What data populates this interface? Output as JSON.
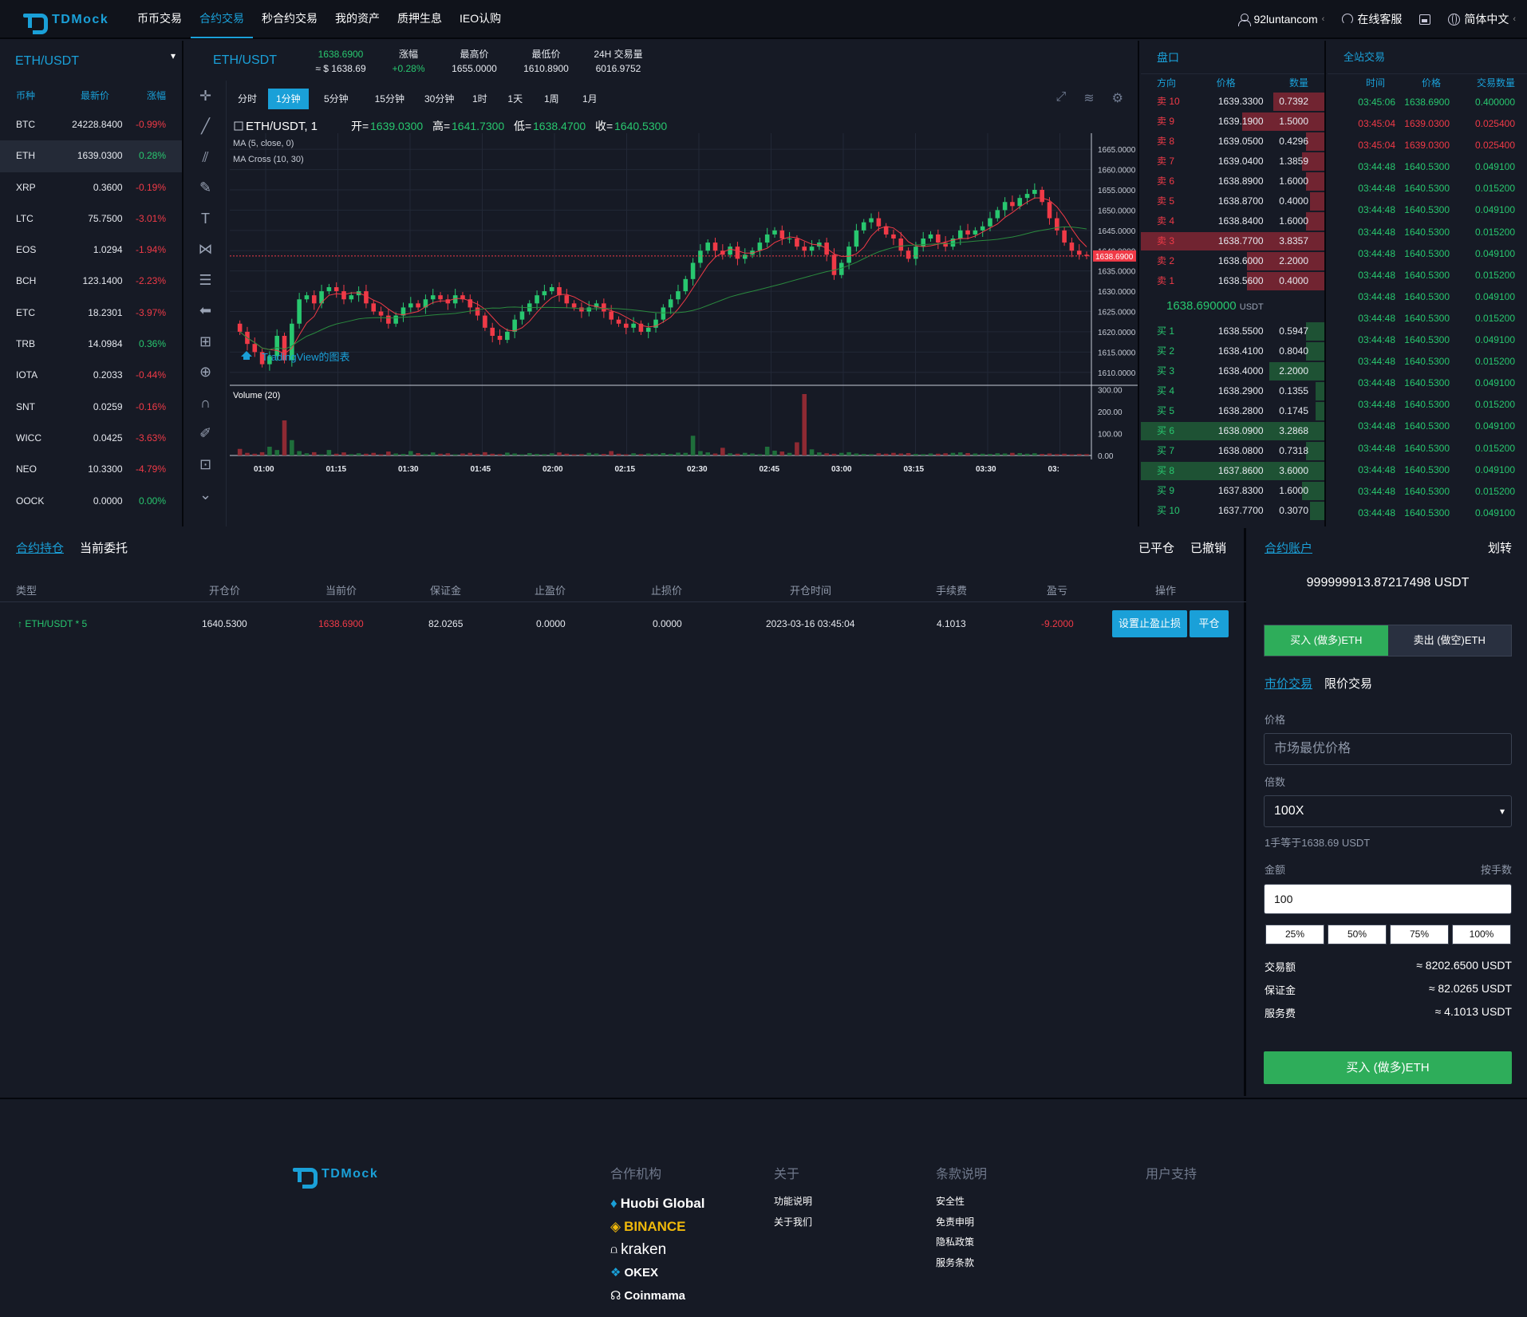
{
  "nav": {
    "brand": "TDMock",
    "items": [
      "币币交易",
      "合约交易",
      "秒合约交易",
      "我的资产",
      "质押生息",
      "IEO认购"
    ],
    "user": "92luntancom",
    "service": "在线客服",
    "lang": "简体中文"
  },
  "sidebar": {
    "title": "ETH/USDT",
    "headers": [
      "币种",
      "最新价",
      "涨幅"
    ],
    "rows": [
      [
        "BTC",
        "24228.8400",
        "-0.99%"
      ],
      [
        "ETH",
        "1639.0300",
        "0.28%"
      ],
      [
        "XRP",
        "0.3600",
        "-0.19%"
      ],
      [
        "LTC",
        "75.7500",
        "-3.01%"
      ],
      [
        "EOS",
        "1.0294",
        "-1.94%"
      ],
      [
        "BCH",
        "123.1400",
        "-2.23%"
      ],
      [
        "ETC",
        "18.2301",
        "-3.97%"
      ],
      [
        "TRB",
        "14.0984",
        "0.36%"
      ],
      [
        "IOTA",
        "0.2033",
        "-0.44%"
      ],
      [
        "SNT",
        "0.0259",
        "-0.16%"
      ],
      [
        "WICC",
        "0.0425",
        "-3.63%"
      ],
      [
        "NEO",
        "10.3300",
        "-4.79%"
      ],
      [
        "OOCK",
        "0.0000",
        "0.00%"
      ]
    ]
  },
  "ticker": {
    "symbol": "ETH/USDT",
    "price": "1638.6900",
    "approx": "≈ $ 1638.69",
    "change_label": "涨幅",
    "change": "+0.28%",
    "high_label": "最高价",
    "high": "1655.0000",
    "low_label": "最低价",
    "low": "1610.8900",
    "vol_label": "24H 交易量",
    "vol": "6016.9752"
  },
  "timeframes": [
    "分时",
    "1分钟",
    "5分钟",
    "15分钟",
    "30分钟",
    "1时",
    "1天",
    "1周",
    "1月"
  ],
  "legend": {
    "title": "ETH/USDT, 1",
    "o_label": "开=",
    "o": "1639.0300",
    "h_label": "高=",
    "h": "1641.7300",
    "l_label": "低=",
    "l": "1638.4700",
    "c_label": "收=",
    "c": "1640.5300",
    "ma": "MA (5, close, 0)",
    "macross": "MA Cross (10, 30)",
    "volume": "Volume (20)",
    "watermark": "TradingView的图表"
  },
  "chart_data": {
    "type": "candlestick",
    "x_ticks": [
      "01:00",
      "01:15",
      "01:30",
      "01:45",
      "02:00",
      "02:15",
      "02:30",
      "02:45",
      "03:00",
      "03:15",
      "03:30",
      "03:"
    ],
    "y_ticks": [
      "1665.0000",
      "1660.0000",
      "1655.0000",
      "1650.0000",
      "1645.0000",
      "1640.0000",
      "1635.0000",
      "1630.0000",
      "1625.0000",
      "1620.0000",
      "1615.0000",
      "1610.0000"
    ],
    "ylim": [
      1607,
      1667
    ],
    "last_price": "1638.6900",
    "vol_ticks": [
      "300.00",
      "200.00",
      "100.00",
      "0.00"
    ],
    "close": [
      1620,
      1617,
      1615,
      1612,
      1614,
      1619,
      1613,
      1622,
      1628,
      1629,
      1627,
      1630,
      1631,
      1630,
      1628,
      1629,
      1630,
      1627,
      1625,
      1624,
      1622,
      1624,
      1626,
      1627,
      1626,
      1628,
      1629,
      1628,
      1627,
      1629,
      1628,
      1626,
      1624,
      1621,
      1619,
      1618,
      1620,
      1623,
      1625,
      1627,
      1629,
      1630,
      1631,
      1629,
      1627,
      1626,
      1625,
      1626,
      1627,
      1625,
      1623,
      1622,
      1621,
      1622,
      1620,
      1621,
      1623,
      1626,
      1628,
      1630,
      1633,
      1637,
      1640,
      1642,
      1640,
      1639,
      1641,
      1638,
      1639,
      1640,
      1642,
      1644,
      1645,
      1643,
      1643,
      1641,
      1640,
      1641,
      1642,
      1639,
      1634,
      1637,
      1641,
      1645,
      1647,
      1648,
      1646,
      1644,
      1643,
      1640,
      1638,
      1641,
      1643,
      1644,
      1642,
      1641,
      1643,
      1645,
      1644,
      1645,
      1646,
      1648,
      1650,
      1652,
      1651,
      1653,
      1654,
      1655,
      1652,
      1648,
      1645,
      1642,
      1640,
      1639,
      1638.69
    ],
    "volume": [
      30,
      12,
      8,
      15,
      40,
      25,
      160,
      70,
      20,
      10,
      15,
      5,
      25,
      8,
      14,
      6,
      10,
      8,
      12,
      5,
      18,
      9,
      7,
      20,
      11,
      6,
      14,
      8,
      10,
      5,
      9,
      12,
      7,
      15,
      8,
      6,
      13,
      9,
      5,
      11,
      7,
      6,
      10,
      14,
      8,
      5,
      6,
      12,
      9,
      7,
      20,
      8,
      5,
      10,
      6,
      9,
      8,
      11,
      7,
      13,
      12,
      90,
      20,
      14,
      9,
      35,
      10,
      8,
      12,
      9,
      6,
      40,
      22,
      18,
      12,
      60,
      280,
      28,
      14,
      10,
      8,
      12,
      15,
      9,
      7,
      6,
      10,
      8,
      12,
      9,
      11,
      7,
      6,
      9,
      8,
      10,
      12,
      14,
      11,
      9,
      8,
      7,
      10,
      9,
      12,
      11,
      8,
      10,
      7,
      9,
      6,
      8,
      5,
      7,
      6
    ],
    "series": [
      {
        "name": "MA (5, close, 0)",
        "color": "#f03a47"
      },
      {
        "name": "MA Cross (10, 30)",
        "color": "#2a8a3e"
      }
    ]
  },
  "book": {
    "title": "盘口",
    "headers": [
      "方向",
      "价格",
      "数量"
    ],
    "asks": [
      [
        "卖 10",
        "1639.3300",
        "0.7392",
        0.28
      ],
      [
        "卖 9",
        "1639.1900",
        "1.5000",
        0.45
      ],
      [
        "卖 8",
        "1639.0500",
        "0.4296",
        0.1
      ],
      [
        "卖 7",
        "1639.0400",
        "1.3859",
        0.12
      ],
      [
        "卖 6",
        "1638.8900",
        "1.6000",
        0.1
      ],
      [
        "卖 5",
        "1638.8700",
        "0.4000",
        0.08
      ],
      [
        "卖 4",
        "1638.8400",
        "1.6000",
        0.1
      ],
      [
        "卖 3",
        "1638.7700",
        "3.8357",
        1.0
      ],
      [
        "卖 2",
        "1638.6000",
        "2.2000",
        0.42
      ],
      [
        "卖 1",
        "1638.5600",
        "0.4000",
        0.42
      ]
    ],
    "mid": "1638.690000",
    "mid_unit": "USDT",
    "bids": [
      [
        "买 1",
        "1638.5500",
        "0.5947",
        0.1
      ],
      [
        "买 2",
        "1638.4100",
        "0.8040",
        0.1
      ],
      [
        "买 3",
        "1638.4000",
        "2.2000",
        0.3
      ],
      [
        "买 4",
        "1638.2900",
        "0.1355",
        0.05
      ],
      [
        "买 5",
        "1638.2800",
        "0.1745",
        0.05
      ],
      [
        "买 6",
        "1638.0900",
        "3.2868",
        1.0
      ],
      [
        "买 7",
        "1638.0800",
        "0.7318",
        0.1
      ],
      [
        "买 8",
        "1637.8600",
        "3.6000",
        1.0
      ],
      [
        "买 9",
        "1637.8300",
        "1.6000",
        0.12
      ],
      [
        "买 10",
        "1637.7700",
        "0.3070",
        0.08
      ]
    ]
  },
  "trades": {
    "title": "全站交易",
    "headers": [
      "时间",
      "价格",
      "交易数量"
    ],
    "rows": [
      [
        "03:45:06",
        "1638.6900",
        "0.400000",
        "up"
      ],
      [
        "03:45:04",
        "1639.0300",
        "0.025400",
        "dn"
      ],
      [
        "03:45:04",
        "1639.0300",
        "0.025400",
        "dn"
      ],
      [
        "03:44:48",
        "1640.5300",
        "0.049100",
        "up"
      ],
      [
        "03:44:48",
        "1640.5300",
        "0.015200",
        "up"
      ],
      [
        "03:44:48",
        "1640.5300",
        "0.049100",
        "up"
      ],
      [
        "03:44:48",
        "1640.5300",
        "0.015200",
        "up"
      ],
      [
        "03:44:48",
        "1640.5300",
        "0.049100",
        "up"
      ],
      [
        "03:44:48",
        "1640.5300",
        "0.015200",
        "up"
      ],
      [
        "03:44:48",
        "1640.5300",
        "0.049100",
        "up"
      ],
      [
        "03:44:48",
        "1640.5300",
        "0.015200",
        "up"
      ],
      [
        "03:44:48",
        "1640.5300",
        "0.049100",
        "up"
      ],
      [
        "03:44:48",
        "1640.5300",
        "0.015200",
        "up"
      ],
      [
        "03:44:48",
        "1640.5300",
        "0.049100",
        "up"
      ],
      [
        "03:44:48",
        "1640.5300",
        "0.015200",
        "up"
      ],
      [
        "03:44:48",
        "1640.5300",
        "0.049100",
        "up"
      ],
      [
        "03:44:48",
        "1640.5300",
        "0.015200",
        "up"
      ],
      [
        "03:44:48",
        "1640.5300",
        "0.049100",
        "up"
      ],
      [
        "03:44:48",
        "1640.5300",
        "0.015200",
        "up"
      ],
      [
        "03:44:48",
        "1640.5300",
        "0.049100",
        "up"
      ]
    ]
  },
  "positions": {
    "tabs": [
      "合约持仓",
      "当前委托"
    ],
    "right_tabs": [
      "已平仓",
      "已撤销"
    ],
    "headers": [
      "类型",
      "开仓价",
      "当前价",
      "保证金",
      "止盈价",
      "止损价",
      "开仓时间",
      "手续费",
      "盈亏",
      "操作"
    ],
    "row": {
      "type": "ETH/USDT * 5",
      "open": "1640.5300",
      "current": "1638.6900",
      "margin": "82.0265",
      "tp": "0.0000",
      "sl": "0.0000",
      "time": "2023-03-16 03:45:04",
      "fee": "4.1013",
      "pnl": "-9.2000",
      "btn_set": "设置止盈止损",
      "btn_close": "平仓"
    }
  },
  "account": {
    "title": "合约账户",
    "transfer": "划转",
    "balance": "999999913.87217498 USDT",
    "buy": "买入 (做多)ETH",
    "sell": "卖出 (做空)ETH",
    "market": "市价交易",
    "limit": "限价交易",
    "price_label": "价格",
    "price_placeholder": "市场最优价格",
    "lev_label": "倍数",
    "leverage": "100X",
    "hint": "1手等于1638.69 USDT",
    "amount_label": "金额",
    "by_lots": "按手数",
    "amount": "100",
    "pcts": [
      "25%",
      "50%",
      "75%",
      "100%"
    ],
    "vol_label": "交易额",
    "vol": "≈ 8202.6500 USDT",
    "margin_label": "保证金",
    "margin": "≈ 82.0265 USDT",
    "fee_label": "服务费",
    "fee": "≈ 4.1013 USDT",
    "submit": "买入 (做多)ETH"
  },
  "footer": {
    "brand": "TDMock",
    "partners_h": "合作机构",
    "partners": [
      "Huobi Global",
      "BINANCE",
      "kraken",
      "OKEX",
      "Coinmama"
    ],
    "about_h": "关于",
    "about": [
      "功能说明",
      "关于我们"
    ],
    "terms_h": "条款说明",
    "terms": [
      "安全性",
      "免责申明",
      "隐私政策",
      "服务条款"
    ],
    "support_h": "用户支持"
  },
  "colors": {
    "accent": "#1aa0d8",
    "up": "#28c76f",
    "down": "#f03a47",
    "bg": "#161a25"
  }
}
